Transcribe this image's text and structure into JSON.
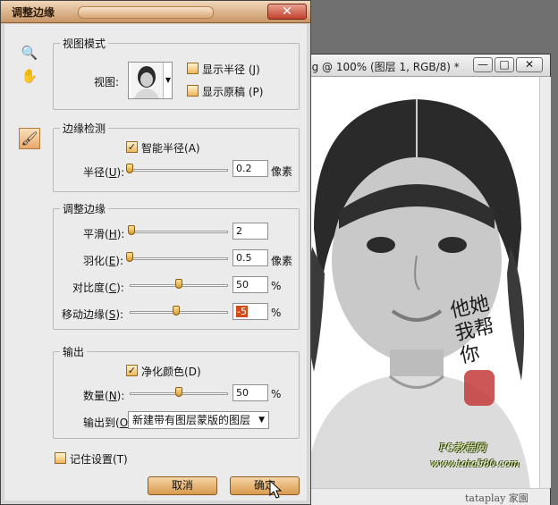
{
  "document_window": {
    "title": "pg @ 100% (图层 1, RGB/8) *",
    "buttons": [
      "—",
      "□",
      "✕"
    ],
    "overlay_text": [
      "他",
      "她",
      "我",
      "帮",
      "你"
    ],
    "site_text": [
      "PS教程网",
      "www.tata580.com"
    ]
  },
  "footer_watermark": "tataplay 家園",
  "dialog": {
    "title": "调整边缘",
    "close": "✕",
    "tools": {
      "zoom": "🔍",
      "hand": "✋",
      "brush": "🖌"
    },
    "view_mode": {
      "legend": "视图模式",
      "view_label": "视图:",
      "show_radius": {
        "label": "显示半径",
        "shortcut": "(J)",
        "checked": false
      },
      "show_original": {
        "label": "显示原稿",
        "shortcut": "(P)",
        "checked": false
      }
    },
    "edge_detection": {
      "legend": "边缘检测",
      "smart_radius": {
        "label": "智能半径",
        "shortcut": "(A)",
        "checked": true
      },
      "radius": {
        "label": "半径(",
        "key": "U",
        "suffix": "):",
        "value": "0.2",
        "unit": "像素",
        "level": 0.0
      }
    },
    "adjust_edge": {
      "legend": "调整边缘",
      "smooth": {
        "label": "平滑(",
        "key": "H",
        "suffix": "):",
        "value": "2",
        "unit": "",
        "level": 0.02
      },
      "feather": {
        "label": "羽化(",
        "key": "E",
        "suffix": "):",
        "value": "0.5",
        "unit": "像素",
        "level": 0.0
      },
      "contrast": {
        "label": "对比度(",
        "key": "C",
        "suffix": "):",
        "value": "50",
        "unit": "%",
        "level": 0.5
      },
      "shift_edge": {
        "label": "移动边缘(",
        "key": "S",
        "suffix": "):",
        "value": "-5",
        "unit": "%",
        "level": 0.47
      }
    },
    "output": {
      "legend": "输出",
      "decontaminate": {
        "label": "净化颜色",
        "shortcut": "(D)",
        "checked": true
      },
      "amount": {
        "label": "数量(",
        "key": "N",
        "suffix": "):",
        "value": "50",
        "unit": "%",
        "level": 0.5
      },
      "output_to": {
        "label": "输出到(",
        "key": "O",
        "suffix": "):",
        "value": "新建带有图层蒙版的图层"
      }
    },
    "remember_settings": {
      "label": "记住设置",
      "shortcut": "(T)",
      "checked": false
    },
    "cancel_label": "取消",
    "ok_label": "确定"
  }
}
